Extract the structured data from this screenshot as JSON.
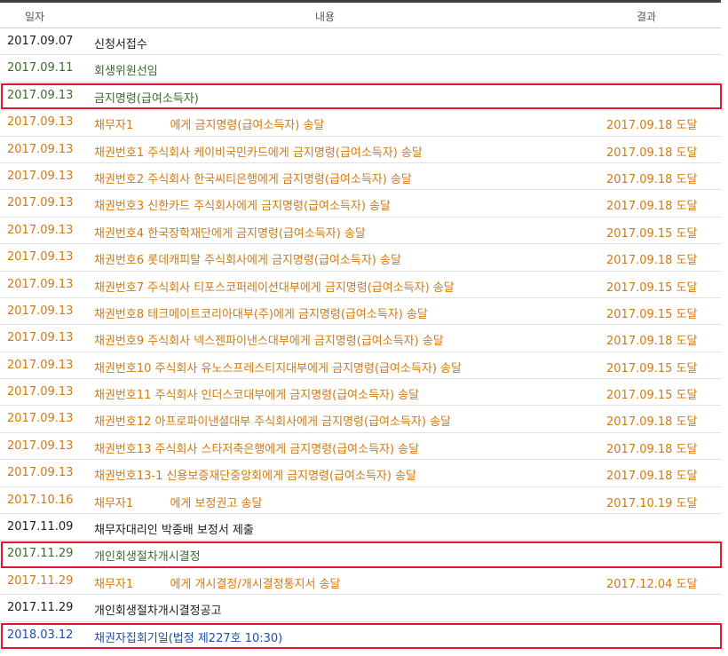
{
  "header": {
    "date": "일자",
    "content": "내용",
    "result": "결과"
  },
  "colors": {
    "black": "#1c1c1c",
    "green": "#3a6b2a",
    "orange": "#d07a12",
    "blue": "#1d4fa8",
    "highlight": "#e0182d"
  },
  "rows": [
    {
      "date": "2017.09.07",
      "content": "신청서접수",
      "result": "",
      "style": "black",
      "highlight": false
    },
    {
      "date": "2017.09.11",
      "content": "회생위원선임",
      "result": "",
      "style": "green",
      "highlight": false
    },
    {
      "date": "2017.09.13",
      "content": "금지명령(급여소득자)",
      "result": "",
      "style": "green",
      "highlight": true
    },
    {
      "date": "2017.09.13",
      "content": "채무자1          에게 금지명령(급여소득자) 송달",
      "result": "2017.09.18 도달",
      "style": "orange",
      "highlight": false
    },
    {
      "date": "2017.09.13",
      "content": "채권번호1 주식회사 케이비국민카드에게 금지명령(급여소득자) 송달",
      "result": "2017.09.18 도달",
      "style": "orange",
      "highlight": false
    },
    {
      "date": "2017.09.13",
      "content": "채권번호2 주식회사 한국씨티은행에게 금지명령(급여소득자) 송달",
      "result": "2017.09.18 도달",
      "style": "orange",
      "highlight": false
    },
    {
      "date": "2017.09.13",
      "content": "채권번호3 신한카드 주식회사에게 금지명령(급여소득자) 송달",
      "result": "2017.09.18 도달",
      "style": "orange",
      "highlight": false
    },
    {
      "date": "2017.09.13",
      "content": "채권번호4 한국장학재단에게 금지명령(급여소득자) 송달",
      "result": "2017.09.15 도달",
      "style": "orange",
      "highlight": false
    },
    {
      "date": "2017.09.13",
      "content": "채권번호6 롯데캐피탈 주식회사에게 금지명령(급여소득자) 송달",
      "result": "2017.09.18 도달",
      "style": "orange",
      "highlight": false
    },
    {
      "date": "2017.09.13",
      "content": "채권번호7 주식회사 티포스코퍼레이션대부에게 금지명령(급여소득자) 송달",
      "result": "2017.09.15 도달",
      "style": "orange",
      "highlight": false
    },
    {
      "date": "2017.09.13",
      "content": "채권번호8 테크메이트코리아대부(주)에게 금지명령(급여소득자) 송달",
      "result": "2017.09.15 도달",
      "style": "orange",
      "highlight": false
    },
    {
      "date": "2017.09.13",
      "content": "채권번호9 주식회사 넥스젠파이낸스대부에게 금지명령(급여소득자) 송달",
      "result": "2017.09.18 도달",
      "style": "orange",
      "highlight": false
    },
    {
      "date": "2017.09.13",
      "content": "채권번호10 주식회사 유노스프레스티지대부에게 금지명령(급여소득자) 송달",
      "result": "2017.09.15 도달",
      "style": "orange",
      "highlight": false
    },
    {
      "date": "2017.09.13",
      "content": "채권번호11 주식회사 인더스코대부에게 금지명령(급여소득자) 송달",
      "result": "2017.09.15 도달",
      "style": "orange",
      "highlight": false
    },
    {
      "date": "2017.09.13",
      "content": "채권번호12 아프로파이낸셜대부 주식회사에게 금지명령(급여소득자) 송달",
      "result": "2017.09.18 도달",
      "style": "orange",
      "highlight": false
    },
    {
      "date": "2017.09.13",
      "content": "채권번호13 주식회사 스타저축은행에게 금지명령(급여소득자) 송달",
      "result": "2017.09.18 도달",
      "style": "orange",
      "highlight": false
    },
    {
      "date": "2017.09.13",
      "content": "채권번호13-1 신용보증재단중앙회에게 금지명령(급여소득자) 송달",
      "result": "2017.09.18 도달",
      "style": "orange",
      "highlight": false
    },
    {
      "date": "2017.10.16",
      "content": "채무자1          에게 보정권고 송달",
      "result": "2017.10.19 도달",
      "style": "orange",
      "highlight": false
    },
    {
      "date": "2017.11.09",
      "content": "채무자대리인 박종배 보정서 제출",
      "result": "",
      "style": "black",
      "highlight": false
    },
    {
      "date": "2017.11.29",
      "content": "개인회생절차개시결정",
      "result": "",
      "style": "green",
      "highlight": true
    },
    {
      "date": "2017.11.29",
      "content": "채무자1          에게 개시결정/개시결정통지서 송달",
      "result": "2017.12.04 도달",
      "style": "orange",
      "highlight": false
    },
    {
      "date": "2017.11.29",
      "content": "개인회생절차개시결정공고",
      "result": "",
      "style": "black",
      "highlight": false
    },
    {
      "date": "2018.03.12",
      "content": "채권자집회기일(법정 제227호 10:30)",
      "result": "",
      "style": "blue",
      "highlight": true
    }
  ]
}
